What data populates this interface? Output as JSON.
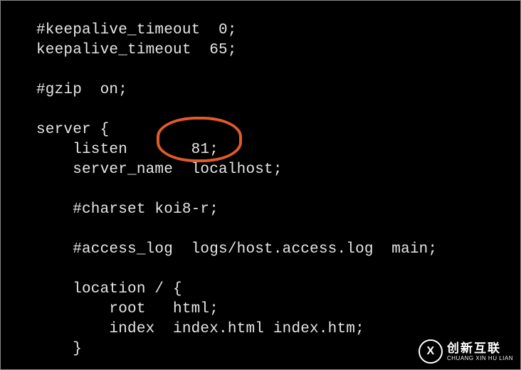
{
  "config": {
    "lines": [
      "#keepalive_timeout  0;",
      "keepalive_timeout  65;",
      "",
      "#gzip  on;",
      "",
      "server {",
      "    listen       81;",
      "    server_name  localhost;",
      "",
      "    #charset koi8-r;",
      "",
      "    #access_log  logs/host.access.log  main;",
      "",
      "    location / {",
      "        root   html;",
      "        index  index.html index.htm;",
      "    }"
    ]
  },
  "annotation": {
    "label": "listen-port-highlight",
    "value": "81"
  },
  "watermark": {
    "main": "创新互联",
    "sub": "CHUANG XIN HU LIAN",
    "icon_letter": "X"
  }
}
